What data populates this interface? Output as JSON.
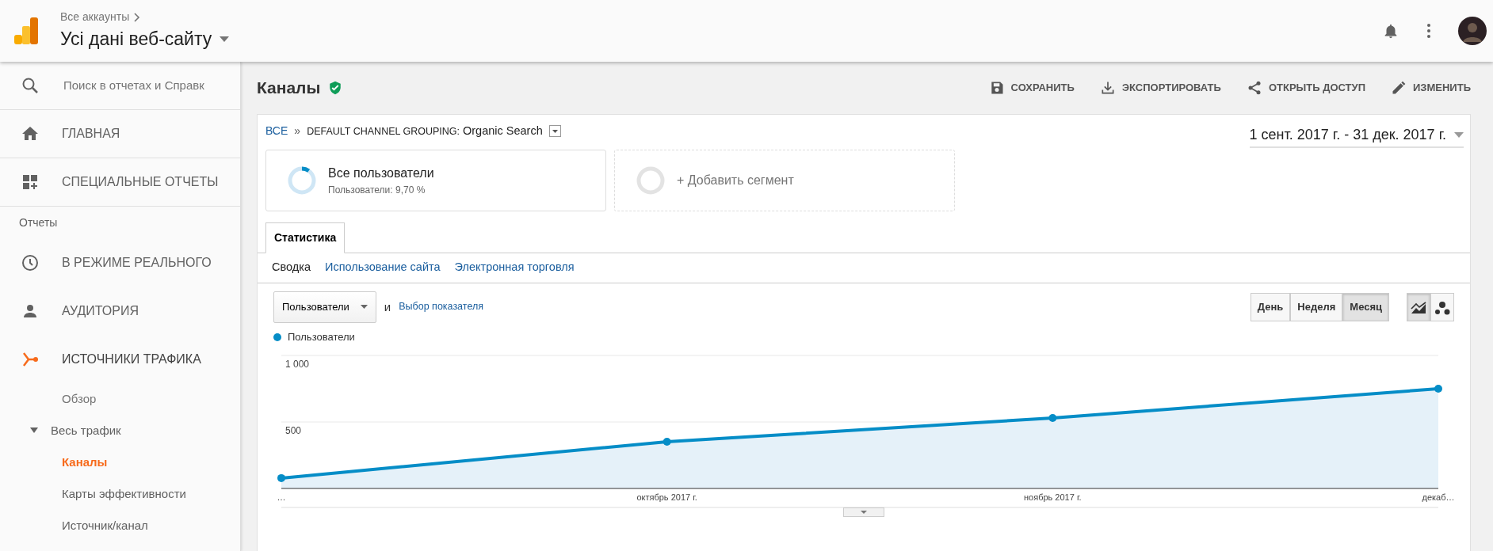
{
  "header": {
    "breadcrumb": "Все аккаунты",
    "view_title": "Усі дані веб-сайту"
  },
  "sidebar": {
    "search": {
      "placeholder": "Поиск в отчетах и Справк"
    },
    "items": [
      {
        "kind": "nav",
        "label": "ГЛАВНАЯ",
        "selected": false
      },
      {
        "kind": "nav",
        "label": "СПЕЦИАЛЬНЫЕ ОТЧЕТЫ",
        "selected": false
      },
      {
        "kind": "section",
        "label": "Отчеты"
      },
      {
        "kind": "nav",
        "label": "В РЕЖИМЕ РЕАЛЬНОГО",
        "selected": false
      },
      {
        "kind": "nav",
        "label": "АУДИТОРИЯ",
        "selected": false
      },
      {
        "kind": "nav",
        "label": "ИСТОЧНИКИ ТРАФИКА",
        "selected": true
      },
      {
        "kind": "sub",
        "label": "Обзор",
        "selected": false
      },
      {
        "kind": "group",
        "label": "Весь трафик",
        "expanded": true,
        "children": [
          {
            "label": "Каналы",
            "selected": true
          },
          {
            "label": "Карты эффективности",
            "selected": false
          },
          {
            "label": "Источник/канал",
            "selected": false
          }
        ]
      }
    ]
  },
  "page": {
    "title": "Каналы",
    "verified": true,
    "actions": [
      {
        "label": "СОХРАНИТЬ"
      },
      {
        "label": "ЭКСПОРТИРОВАТЬ"
      },
      {
        "label": "ОТКРЫТЬ ДОСТУП"
      },
      {
        "label": "ИЗМЕНИТЬ"
      }
    ],
    "breadcrumb": {
      "root": "ВСЕ",
      "separator": "»",
      "dimension": "DEFAULT CHANNEL GROUPING:",
      "value": "Organic Search"
    },
    "date_range": "1 сент. 2017 г. - 31 дек. 2017 г.",
    "segments": [
      {
        "kind": "segment",
        "name": "Все пользователи",
        "detail": "Пользователи: 9,70 %",
        "level": 0.097
      },
      {
        "kind": "add",
        "label": "+ Добавить сегмент"
      }
    ],
    "tabs": [
      {
        "label": "Статистика",
        "selected": true
      }
    ],
    "subtabs": [
      {
        "label": "Сводка",
        "selected": true
      },
      {
        "label": "Использование сайта",
        "selected": false
      },
      {
        "label": "Электронная торговля",
        "selected": false
      }
    ],
    "metric_select": "Пользователи",
    "conjunction": "и",
    "metric_link": "Выбор показателя",
    "periods": [
      {
        "label": "День",
        "selected": false
      },
      {
        "label": "Неделя",
        "selected": false
      },
      {
        "label": "Месяц",
        "selected": true
      }
    ],
    "chart_types": [
      {
        "kind": "line",
        "selected": true
      },
      {
        "kind": "motion",
        "selected": false
      }
    ],
    "chart_data": {
      "type": "line",
      "categories": [
        "…",
        "октябрь 2017 г.",
        "ноябрь 2017 г.",
        "декаб…"
      ],
      "series": [
        {
          "name": "Пользователи",
          "color": "#058dc7",
          "marker": "circle",
          "values": [
            78,
            351,
            530,
            750
          ]
        }
      ],
      "ylim": [
        0,
        1000
      ],
      "yticks": [
        500,
        {
          "value": 1000,
          "label": "1 000"
        }
      ]
    }
  }
}
